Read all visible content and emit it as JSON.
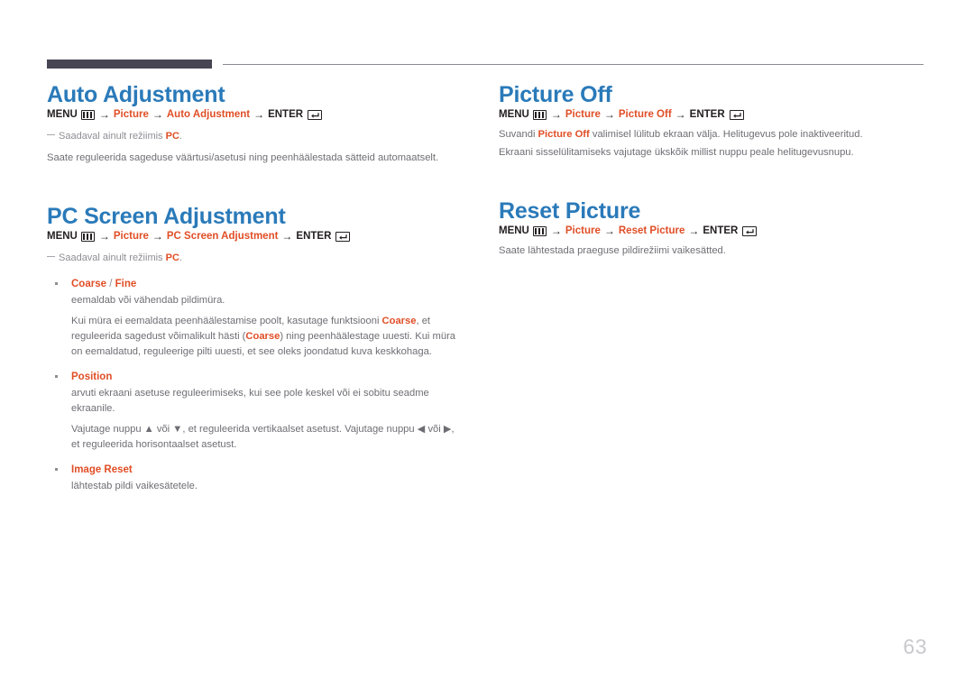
{
  "header": {
    "rule_color": "#474453",
    "thin_rule_color": "#8d8b92"
  },
  "colors": {
    "title_blue": "#2a7ab9",
    "highlight_orange": "#e04e26",
    "body_gray": "#6f6d73",
    "note_gray": "#8f8d93",
    "page_number_gray": "#c9c8cc"
  },
  "icons": {
    "menu": "menu-icon",
    "enter": "enter-icon"
  },
  "labels": {
    "menu": "MENU",
    "enter": "ENTER",
    "arrow": "→",
    "picture": "Picture",
    "up_arrow": "▲",
    "down_arrow": "▼",
    "left_arrow": "◀",
    "right_arrow": "▶"
  },
  "sections": {
    "auto_adjustment": {
      "title": "Auto Adjustment",
      "path_item": "Auto Adjustment",
      "note_before": "Saadaval ainult režiimis ",
      "note_hl": "PC",
      "note_after": ".",
      "body": "Saate reguleerida sageduse väärtusi/asetusi ning peenhäälestada sätteid automaatselt."
    },
    "pc_screen_adjustment": {
      "title": "PC Screen Adjustment",
      "path_item": "PC Screen Adjustment",
      "note_before": "Saadaval ainult režiimis ",
      "note_hl": "PC",
      "note_after": ".",
      "bullets": [
        {
          "name": "coarse-fine",
          "head_part1": "Coarse",
          "head_sep": " / ",
          "head_part2": "Fine",
          "line1": "eemaldab või vähendab pildimüra.",
          "para_a1": "Kui müra ei eemaldata peenhäälestamise poolt, kasutage funktsiooni ",
          "para_hl1": "Coarse",
          "para_a2": ", et reguleerida sagedust võimalikult hästi (",
          "para_hl2": "Coarse",
          "para_a3": ") ning peenhäälestage uuesti. Kui müra on eemaldatud, reguleerige pilti uuesti, et see oleks joondatud kuva keskkohaga."
        },
        {
          "name": "position",
          "head_part1": "Position",
          "line1": "arvuti ekraani asetuse reguleerimiseks, kui see pole keskel või ei sobitu seadme ekraanile.",
          "para_a1": "Vajutage nuppu ",
          "para_a2": " või ",
          "para_a3": ", et reguleerida vertikaalset asetust. Vajutage nuppu ",
          "para_a4": " või ",
          "para_a5": ", et reguleerida horisontaalset asetust."
        },
        {
          "name": "image-reset",
          "head_part1": "Image Reset",
          "line1": "lähtestab pildi vaikesätetele."
        }
      ]
    },
    "picture_off": {
      "title": "Picture Off",
      "path_item": "Picture Off",
      "body1_before": "Suvandi ",
      "body1_hl": "Picture Off",
      "body1_after": " valimisel lülitub ekraan välja. Helitugevus pole inaktiveeritud.",
      "body2": "Ekraani sisselülitamiseks vajutage ükskõik millist nuppu peale helitugevusnupu."
    },
    "reset_picture": {
      "title": "Reset Picture",
      "path_item": "Reset Picture",
      "body": "Saate lähtestada praeguse pildirežiimi vaikesätted."
    }
  },
  "footer": {
    "page_number": "63"
  }
}
